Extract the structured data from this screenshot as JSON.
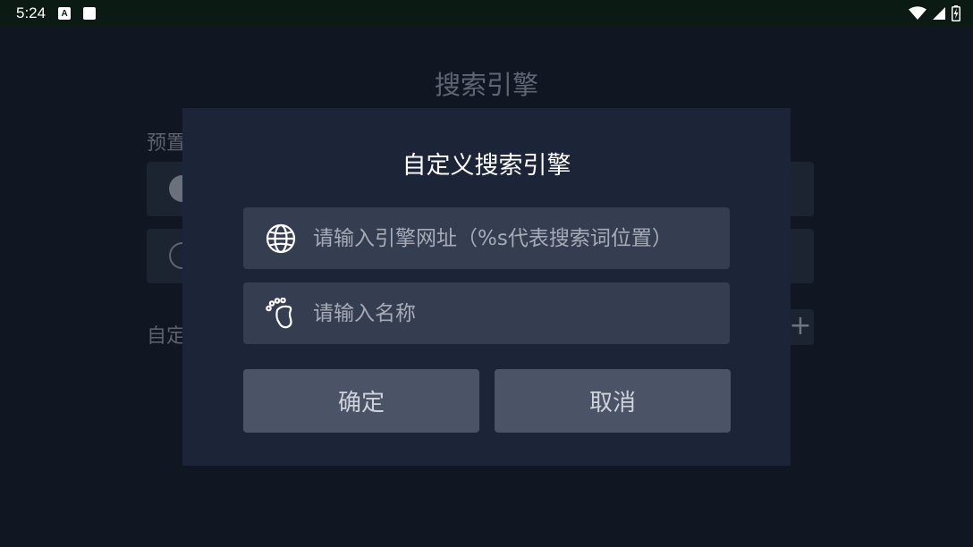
{
  "status_bar": {
    "time": "5:24",
    "notification_badge": "A",
    "icons": [
      "a-notification-icon",
      "square-notification-icon",
      "wifi-icon",
      "cellular-signal-icon",
      "battery-charging-icon"
    ]
  },
  "background_page": {
    "title": "搜索引擎",
    "preset_section_label": "预置",
    "custom_section_label": "自定",
    "add_button_label": "+"
  },
  "dialog": {
    "title": "自定义搜索引擎",
    "url_field": {
      "placeholder": "请输入引擎网址（%s代表搜索词位置）",
      "value": "",
      "icon": "globe-icon"
    },
    "name_field": {
      "placeholder": "请输入名称",
      "value": "",
      "icon": "footprint-icon"
    },
    "confirm_label": "确定",
    "cancel_label": "取消"
  },
  "colors": {
    "status_bar_bg": "#0b1a12",
    "page_bg": "#111722",
    "dialog_bg": "#1c2438",
    "field_bg": "#353d51",
    "button_bg": "#4b5366"
  }
}
